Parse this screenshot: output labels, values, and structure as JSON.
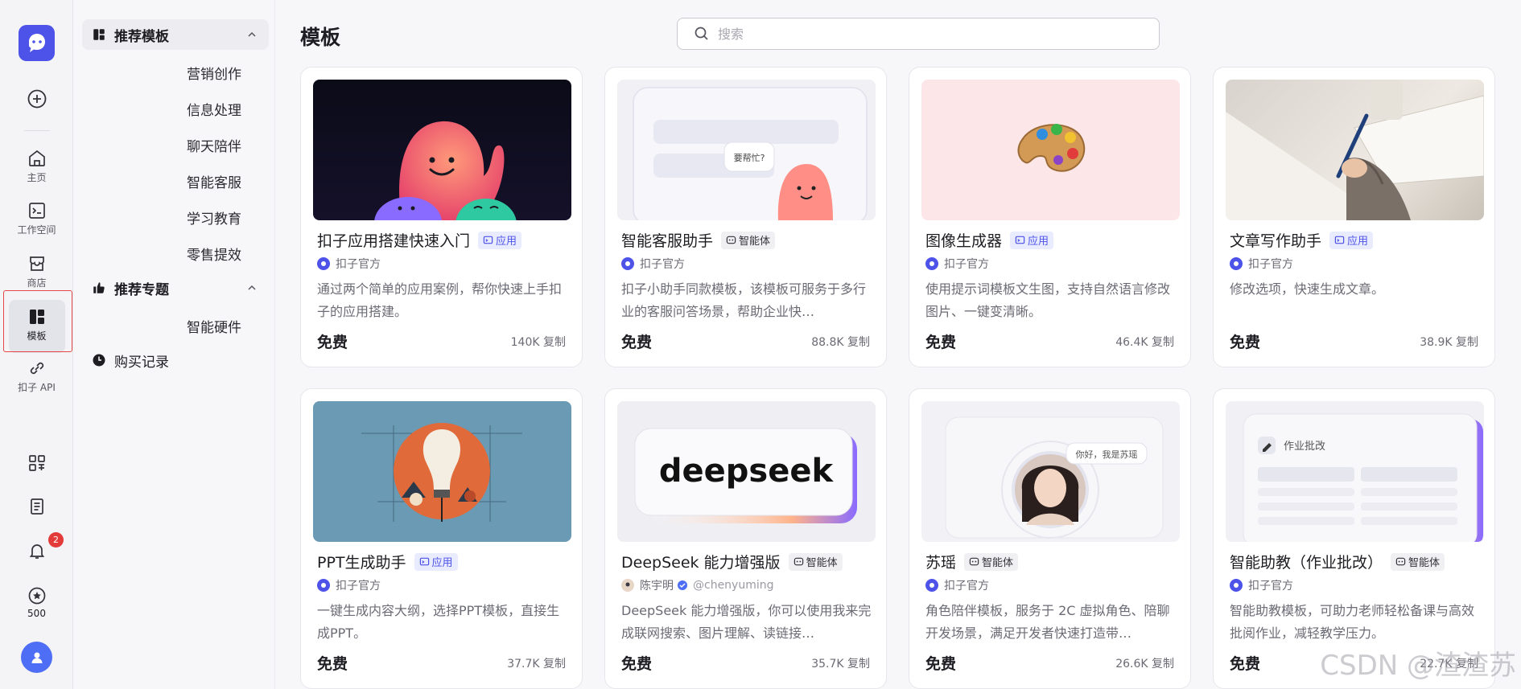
{
  "rail": {
    "home_label": "主页",
    "workspace_label": "工作空间",
    "store_label": "商店",
    "templates_label": "模板",
    "api_label": "扣子 API",
    "notification_count": "2",
    "points": "500"
  },
  "sidebar": {
    "group1": "推荐模板",
    "sub1": [
      "营销创作",
      "信息处理",
      "聊天陪伴",
      "智能客服",
      "学习教育",
      "零售提效"
    ],
    "group2": "推荐专题",
    "sub2": [
      "智能硬件"
    ],
    "group3": "购买记录"
  },
  "main": {
    "title": "模板",
    "search_placeholder": "搜索"
  },
  "cards": [
    {
      "title": "扣子应用搭建快速入门",
      "tag": "应用",
      "tag_type": "app",
      "author": "扣子官方",
      "desc": "通过两个简单的应用案例，帮你快速上手扣子的应用搭建。",
      "price": "免费",
      "copies": "140K 复制"
    },
    {
      "title": "智能客服助手",
      "tag": "智能体",
      "tag_type": "agent",
      "author": "扣子官方",
      "desc": "扣子小助手同款模板，该模板可服务于多行业的客服问答场景，帮助企业快…",
      "price": "免费",
      "copies": "88.8K 复制",
      "img_text": "要帮忙?"
    },
    {
      "title": "图像生成器",
      "tag": "应用",
      "tag_type": "app",
      "author": "扣子官方",
      "desc": "使用提示词模板文生图，支持自然语言修改图片、一键变清晰。",
      "price": "免费",
      "copies": "46.4K 复制"
    },
    {
      "title": "文章写作助手",
      "tag": "应用",
      "tag_type": "app",
      "author": "扣子官方",
      "desc": "修改选项，快速生成文章。",
      "price": "免费",
      "copies": "38.9K 复制"
    },
    {
      "title": "PPT生成助手",
      "tag": "应用",
      "tag_type": "app",
      "author": "扣子官方",
      "desc": "一键生成内容大纲，选择PPT模板，直接生成PPT。",
      "price": "免费",
      "copies": "37.7K 复制"
    },
    {
      "title": "DeepSeek 能力增强版",
      "tag": "智能体",
      "tag_type": "agent",
      "author": "陈宇明",
      "handle": "@chenyuming",
      "desc": "DeepSeek 能力增强版，你可以使用我来完成联网搜索、图片理解、读链接…",
      "price": "免费",
      "copies": "35.7K 复制",
      "img_text": "deepseek"
    },
    {
      "title": "苏瑶",
      "tag": "智能体",
      "tag_type": "agent",
      "author": "扣子官方",
      "desc": "角色陪伴模板，服务于 2C 虚拟角色、陪聊开发场景，满足开发者快速打造带…",
      "price": "免费",
      "copies": "26.6K 复制",
      "img_text": "你好，我是苏瑶"
    },
    {
      "title": "智能助教（作业批改）",
      "tag": "智能体",
      "tag_type": "agent",
      "author": "扣子官方",
      "desc": "智能助教模板，可助力老师轻松备课与高效批阅作业，减轻教学压力。",
      "price": "免费",
      "copies": "22.7K 复制",
      "img_text": "作业批改"
    }
  ],
  "watermark": "CSDN @渣渣苏"
}
